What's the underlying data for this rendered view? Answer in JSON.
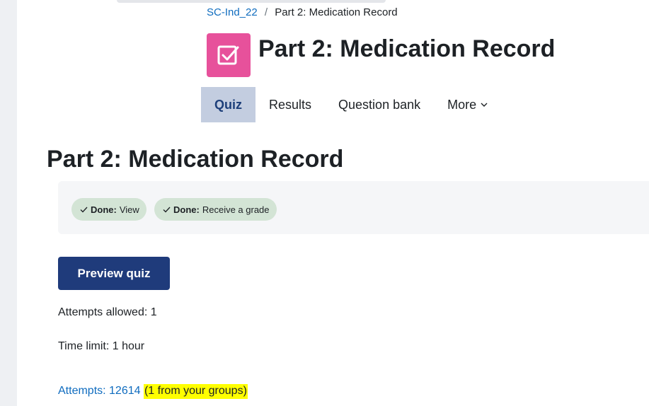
{
  "breadcrumb": {
    "course": "SC-Ind_22",
    "separator": "/",
    "current": "Part 2: Medication Record"
  },
  "header": {
    "icon": "quiz-checkbox-icon",
    "title": "Part 2: Medication Record"
  },
  "tabs": [
    {
      "label": "Quiz",
      "active": true
    },
    {
      "label": "Results",
      "active": false
    },
    {
      "label": "Question bank",
      "active": false
    },
    {
      "label": "More",
      "active": false
    }
  ],
  "page_heading": "Part 2: Medication Record",
  "completion": [
    {
      "status": "Done:",
      "label": "View"
    },
    {
      "status": "Done:",
      "label": "Receive a grade"
    }
  ],
  "actions": {
    "preview_label": "Preview quiz"
  },
  "info": {
    "attempts_allowed": "Attempts allowed: 1",
    "time_limit": "Time limit: 1 hour"
  },
  "attempts_link": {
    "text": "Attempts: 12614",
    "highlight": "(1 from your groups)"
  },
  "colors": {
    "accent": "#1f3b7b",
    "icon_bg": "#e7519b",
    "active_tab_bg": "#c3cde0",
    "badge_bg": "#d3e4d5",
    "highlight": "#ffff00"
  }
}
